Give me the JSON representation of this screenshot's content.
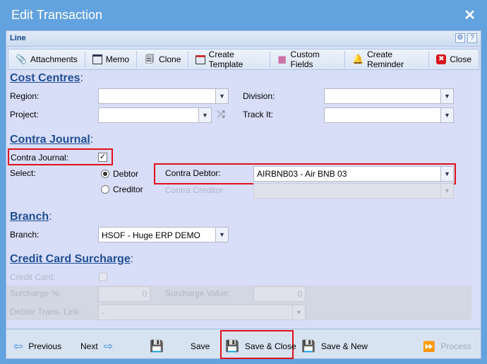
{
  "window": {
    "title": "Edit Transaction",
    "close": "✕"
  },
  "panel": {
    "title": "Line"
  },
  "toolbar": [
    {
      "label": "Attachments",
      "icon": "paperclip-icon",
      "glyph": "📎"
    },
    {
      "label": "Memo",
      "icon": "memo-icon",
      "glyph": "▭"
    },
    {
      "label": "Clone",
      "icon": "clone-icon",
      "glyph": "📄"
    },
    {
      "label": "Create Template",
      "icon": "template-icon",
      "glyph": "▤"
    },
    {
      "label": "Custom Fields",
      "icon": "grid-icon",
      "glyph": "▦"
    },
    {
      "label": "Create Reminder",
      "icon": "bell-icon",
      "glyph": "🔔"
    },
    {
      "label": "Close",
      "icon": "close-icon",
      "glyph": "✖"
    }
  ],
  "cost_centres": {
    "heading": "Cost Centres",
    "region": "Region:",
    "division": "Division:",
    "project": "Project:",
    "track_it": "Track It:",
    "region_value": "",
    "division_value": "",
    "project_value": "",
    "track_it_value": ""
  },
  "contra": {
    "heading": "Contra Journal",
    "checkbox_label": "Contra Journal:",
    "checked": true,
    "select": "Select:",
    "debtor": "Debtor",
    "creditor": "Creditor",
    "selected": "Debtor",
    "contra_debtor": "Contra Debtor:",
    "contra_debtor_value": "AIRBNB03 - Air BNB 03",
    "contra_creditor": "Contra Creditor:",
    "contra_creditor_value": ""
  },
  "branch": {
    "heading": "Branch",
    "label": "Branch:",
    "value": "HSOF - Huge ERP DEMO"
  },
  "surcharge": {
    "heading": "Credit Card Surcharge",
    "credit_card": "Credit Card:",
    "surcharge_pct": "Surcharge %:",
    "surcharge_pct_value": "0",
    "surcharge_value": "Surcharge Value:",
    "surcharge_value_value": "0",
    "debtor_link": "Debtor Trans. Link:",
    "debtor_link_value": "-"
  },
  "footer": {
    "previous": "Previous",
    "next": "Next",
    "save": "Save",
    "save_close": "Save & Close",
    "save_new": "Save & New",
    "process": "Process"
  },
  "colors": {
    "window": "#62a2de",
    "panel": "#d8def7",
    "heading": "#1f4e95",
    "highlight": "#e0101a"
  }
}
